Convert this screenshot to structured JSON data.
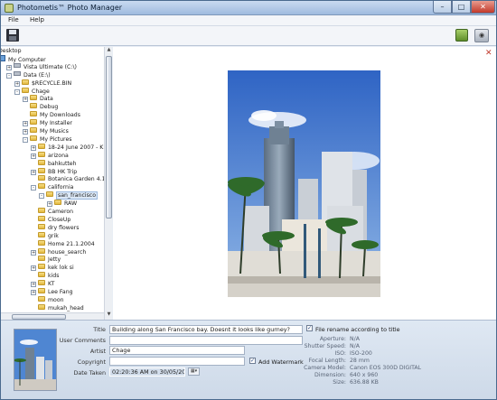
{
  "window": {
    "title": "Photometis™ Photo Manager"
  },
  "menu": {
    "file": "File",
    "help": "Help"
  },
  "tree": {
    "items": [
      {
        "label": "Desktop",
        "indent": 0,
        "type": "none",
        "exp": ""
      },
      {
        "label": "My Computer",
        "indent": 0,
        "type": "comp",
        "exp": ""
      },
      {
        "label": "Vista Ultimate (C:\\)",
        "indent": 1,
        "type": "drive",
        "exp": "+"
      },
      {
        "label": "Data (E:\\)",
        "indent": 1,
        "type": "drive",
        "exp": "-"
      },
      {
        "label": "$RECYCLE.BIN",
        "indent": 2,
        "type": "fold",
        "exp": "+"
      },
      {
        "label": "Chage",
        "indent": 2,
        "type": "fold",
        "exp": "-"
      },
      {
        "label": "Data",
        "indent": 3,
        "type": "fold",
        "exp": "+"
      },
      {
        "label": "Debug",
        "indent": 3,
        "type": "fold",
        "exp": ""
      },
      {
        "label": "My Downloads",
        "indent": 3,
        "type": "fold",
        "exp": ""
      },
      {
        "label": "My Installer",
        "indent": 3,
        "type": "fold",
        "exp": "+"
      },
      {
        "label": "My Musics",
        "indent": 3,
        "type": "fold",
        "exp": "+"
      },
      {
        "label": "My Pictures",
        "indent": 3,
        "type": "fold",
        "exp": "-"
      },
      {
        "label": "18-24 June 2007 - KK",
        "indent": 4,
        "type": "fold",
        "exp": "+"
      },
      {
        "label": "arizona",
        "indent": 4,
        "type": "fold",
        "exp": "+"
      },
      {
        "label": "bahkutteh",
        "indent": 4,
        "type": "fold",
        "exp": ""
      },
      {
        "label": "BB HK Trip",
        "indent": 4,
        "type": "fold",
        "exp": "+"
      },
      {
        "label": "Botanica Garden 4.1.2",
        "indent": 4,
        "type": "fold",
        "exp": ""
      },
      {
        "label": "california",
        "indent": 4,
        "type": "fold",
        "exp": "-"
      },
      {
        "label": "san_francisco",
        "indent": 5,
        "type": "fold",
        "exp": "-",
        "selected": true
      },
      {
        "label": "RAW",
        "indent": 6,
        "type": "fold",
        "exp": "+"
      },
      {
        "label": "Cameron",
        "indent": 4,
        "type": "fold",
        "exp": ""
      },
      {
        "label": "CloseUp",
        "indent": 4,
        "type": "fold",
        "exp": ""
      },
      {
        "label": "dry flowers",
        "indent": 4,
        "type": "fold",
        "exp": ""
      },
      {
        "label": "grik",
        "indent": 4,
        "type": "fold",
        "exp": ""
      },
      {
        "label": "Home 21.1.2004",
        "indent": 4,
        "type": "fold",
        "exp": ""
      },
      {
        "label": "house_search",
        "indent": 4,
        "type": "fold",
        "exp": "+"
      },
      {
        "label": "Jetty",
        "indent": 4,
        "type": "fold",
        "exp": ""
      },
      {
        "label": "kek lok si",
        "indent": 4,
        "type": "fold",
        "exp": "+"
      },
      {
        "label": "kids",
        "indent": 4,
        "type": "fold",
        "exp": ""
      },
      {
        "label": "KT",
        "indent": 4,
        "type": "fold",
        "exp": "+"
      },
      {
        "label": "Lee Fang",
        "indent": 4,
        "type": "fold",
        "exp": "+"
      },
      {
        "label": "moon",
        "indent": 4,
        "type": "fold",
        "exp": ""
      },
      {
        "label": "mukah_head",
        "indent": 4,
        "type": "fold",
        "exp": ""
      },
      {
        "label": "Nov-Dec 2007 Oregon",
        "indent": 4,
        "type": "fold",
        "exp": "+"
      }
    ]
  },
  "form": {
    "title_label": "Title",
    "title_value": "Building along San Francisco bay. Doesnt it looks like gurney?",
    "comments_label": "User Comments",
    "comments_value": "",
    "artist_label": "Artist",
    "artist_value": "Chage",
    "copyright_label": "Copyright",
    "copyright_value": "",
    "date_label": "Date Taken",
    "date_value": "02:20:36 AM on 30/05/2005",
    "watermark_label": "Add Watermark",
    "rename_label": "File rename according to title"
  },
  "metadata": [
    {
      "label": "Aperture:",
      "value": "N/A"
    },
    {
      "label": "Shutter Speed:",
      "value": "N/A"
    },
    {
      "label": "ISO:",
      "value": "ISO-200"
    },
    {
      "label": "Focal Length:",
      "value": "28 mm"
    },
    {
      "label": "Camera Model:",
      "value": "Canon EOS 300D DIGITAL"
    },
    {
      "label": "Dimension:",
      "value": "640 x 960"
    },
    {
      "label": "Size:",
      "value": "636.88 KB"
    }
  ]
}
